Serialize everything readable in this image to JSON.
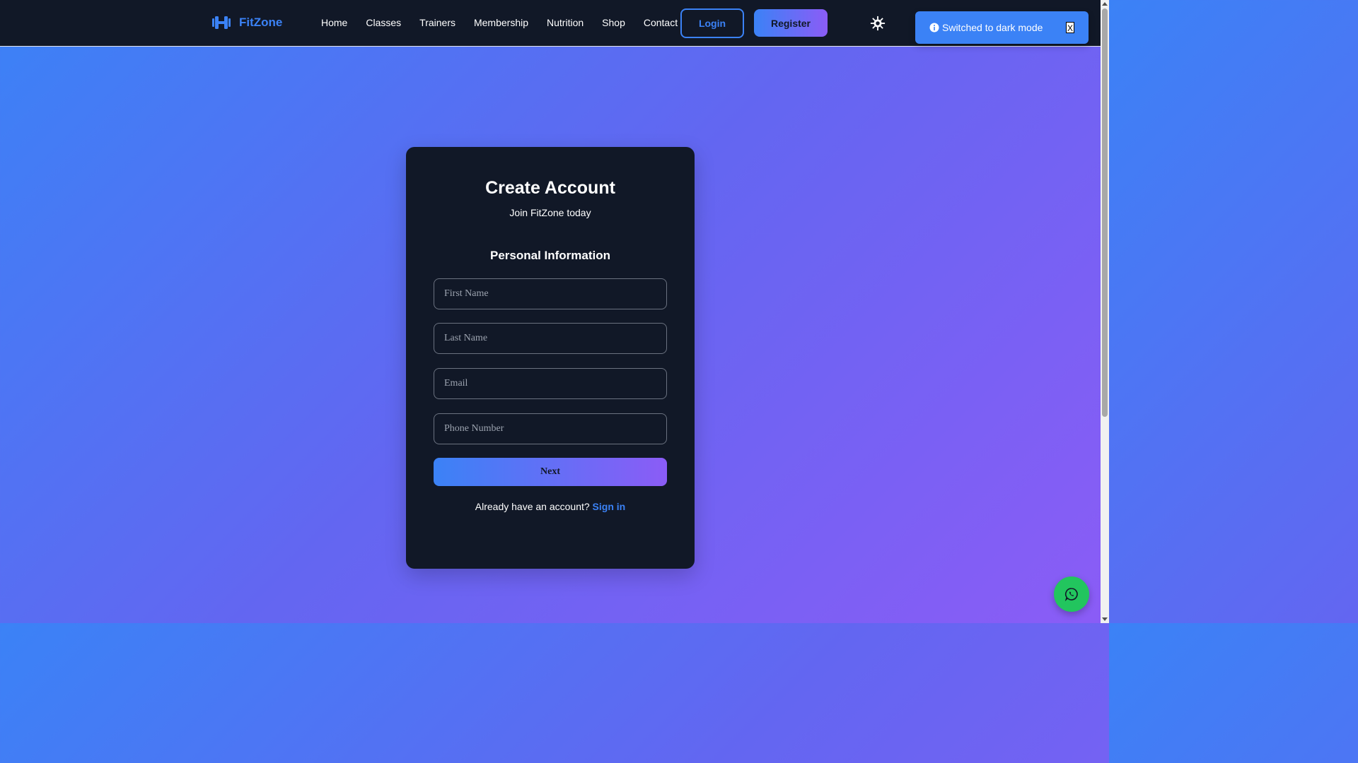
{
  "header": {
    "brand": "FitZone",
    "nav": [
      "Home",
      "Classes",
      "Trainers",
      "Membership",
      "Nutrition",
      "Shop",
      "Contact"
    ],
    "login_label": "Login",
    "register_label": "Register",
    "theme_icon": "sun-icon"
  },
  "toast": {
    "message": "Switched to dark mode",
    "close_label": "X",
    "icon": "info-icon"
  },
  "form": {
    "title": "Create Account",
    "subtitle": "Join FitZone today",
    "section_title": "Personal Information",
    "fields": {
      "first_name_placeholder": "First Name",
      "last_name_placeholder": "Last Name",
      "email_placeholder": "Email",
      "phone_placeholder": "Phone Number"
    },
    "next_label": "Next",
    "signin_prompt": "Already have an account?",
    "signin_link": "Sign in"
  },
  "floating": {
    "icon": "whatsapp-icon"
  },
  "colors": {
    "accent": "#3b82f6",
    "accent_end": "#8b5cf6",
    "navbar_bg": "#111827",
    "whatsapp": "#22c55e"
  }
}
